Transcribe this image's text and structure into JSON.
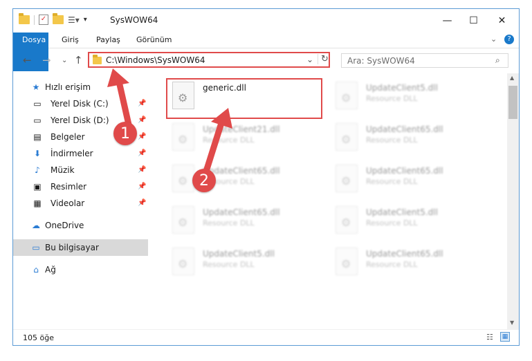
{
  "title": "SysWOW64",
  "ribbon": {
    "tabs": [
      "Dosya",
      "Giriş",
      "Paylaş",
      "Görünüm"
    ]
  },
  "nav": {
    "path": "C:\\Windows\\SysWOW64",
    "search_placeholder": "Ara: SysWOW64"
  },
  "sidebar": {
    "quick_access": "Hızlı erişim",
    "items": [
      "Yerel Disk (C:)",
      "Yerel Disk (D:)",
      "Belgeler",
      "İndirmeler",
      "Müzik",
      "Resimler",
      "Videolar"
    ],
    "onedrive": "OneDrive",
    "this_pc": "Bu bilgisayar",
    "network": "Ağ"
  },
  "files": [
    {
      "name": "generic.dll",
      "type": ""
    },
    {
      "name": "UpdateClient5.dll",
      "type": "Resource DLL"
    },
    {
      "name": "UpdateClient21.dll",
      "type": "Resource DLL"
    },
    {
      "name": "UpdateClient65.dll",
      "type": "Resource DLL"
    },
    {
      "name": "UpdateClient65.dll",
      "type": "Resource DLL"
    },
    {
      "name": "UpdateClient65.dll",
      "type": "Resource DLL"
    },
    {
      "name": "UpdateClient65.dll",
      "type": "Resource DLL"
    },
    {
      "name": "UpdateClient5.dll",
      "type": "Resource DLL"
    },
    {
      "name": "UpdateClient5.dll",
      "type": "Resource DLL"
    },
    {
      "name": "UpdateClient65.dll",
      "type": "Resource DLL"
    }
  ],
  "status": {
    "count": "105 öğe"
  },
  "annotations": {
    "badge1": "1",
    "badge2": "2"
  },
  "colors": {
    "accent": "#1979ca",
    "highlight": "#e04a4a"
  }
}
